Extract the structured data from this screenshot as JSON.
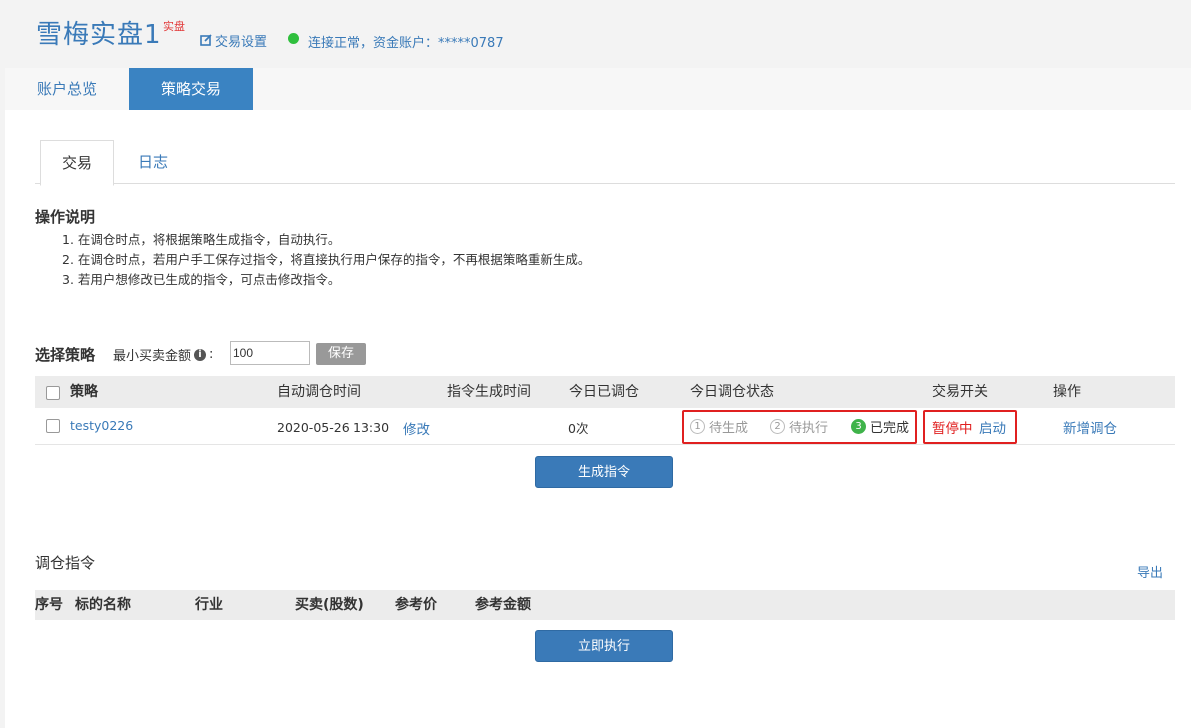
{
  "header": {
    "title": "雪梅实盘1",
    "badge": "实盘",
    "settings_label": "交易设置",
    "status_text": "连接正常，资金账户：*****0787",
    "status_color": "#2fbf3d"
  },
  "topnav": {
    "tabs": [
      {
        "label": "账户总览",
        "active": false
      },
      {
        "label": "策略交易",
        "active": true
      }
    ]
  },
  "subtabs": [
    {
      "label": "交易",
      "active": true
    },
    {
      "label": "日志",
      "active": false
    }
  ],
  "instructions": {
    "title": "操作说明",
    "items": [
      "1. 在调仓时点，将根据策略生成指令，自动执行。",
      "2. 在调仓时点，若用户手工保存过指令，将直接执行用户保存的指令，不再根据策略重新生成。",
      "3. 若用户想修改已生成的指令，可点击修改指令。"
    ]
  },
  "strategy_select": {
    "title": "选择策略",
    "min_amount_label": "最小买卖金额",
    "min_amount_value": "100",
    "save_label": "保存"
  },
  "strategy_table": {
    "headers": [
      "策略",
      "自动调仓时间",
      "指令生成时间",
      "今日已调仓",
      "今日调仓状态",
      "交易开关",
      "操作"
    ],
    "rows": [
      {
        "name": "testy0226",
        "date": "2020-05-26",
        "time": "13:30",
        "modify_label": "修改",
        "gen_time": "",
        "today_count": "0次",
        "steps": [
          {
            "num": "1",
            "label": "待生成",
            "done": false
          },
          {
            "num": "2",
            "label": "待执行",
            "done": false
          },
          {
            "num": "3",
            "label": "已完成",
            "done": true
          }
        ],
        "switch_state": "暂停中",
        "switch_action": "启动",
        "action_label": "新增调仓"
      }
    ]
  },
  "generate_label": "生成指令",
  "orders": {
    "title": "调仓指令",
    "export_label": "导出",
    "headers": [
      "序号",
      "标的名称",
      "行业",
      "买卖(股数)",
      "参考价",
      "参考金额"
    ],
    "execute_label": "立即执行"
  },
  "colors": {
    "accent": "#3a7ab8",
    "danger": "#e02020",
    "success": "#3fb34a"
  }
}
